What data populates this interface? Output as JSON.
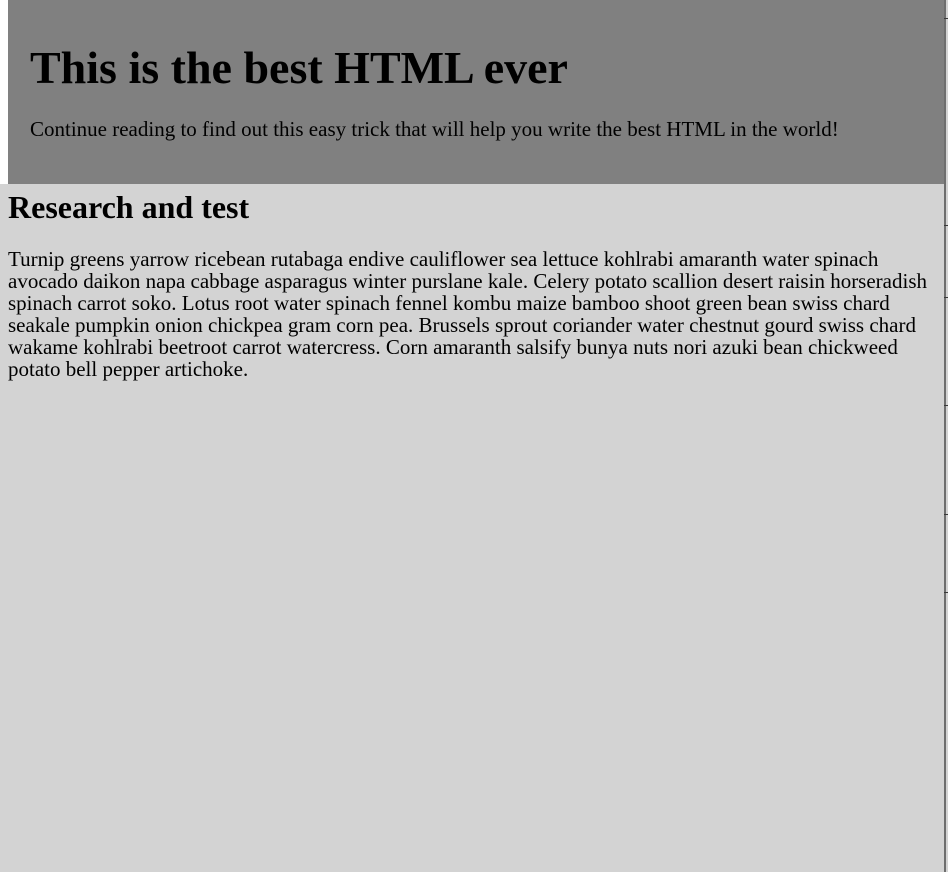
{
  "hero": {
    "title": "This is the best HTML ever",
    "subtitle": "Continue reading to find out this easy trick that will help you write the best HTML in the world!"
  },
  "section": {
    "title": "Research and test",
    "body": "Turnip greens yarrow ricebean rutabaga endive cauliflower sea lettuce kohlrabi amaranth water spinach avocado daikon napa cabbage asparagus winter purslane kale. Celery potato scallion desert raisin horseradish spinach carrot soko. Lotus root water spinach fennel kombu maize bamboo shoot green bean swiss chard seakale pumpkin onion chickpea gram corn pea. Brussels sprout coriander water chestnut gourd swiss chard wakame kohlrabi beetroot carrot watercress. Corn amaranth salsify bunya nuts nori azuki bean chickweed potato bell pepper artichoke."
  },
  "colors": {
    "page_background": "#d3d3d3",
    "hero_background": "#808080",
    "text": "#000000"
  }
}
